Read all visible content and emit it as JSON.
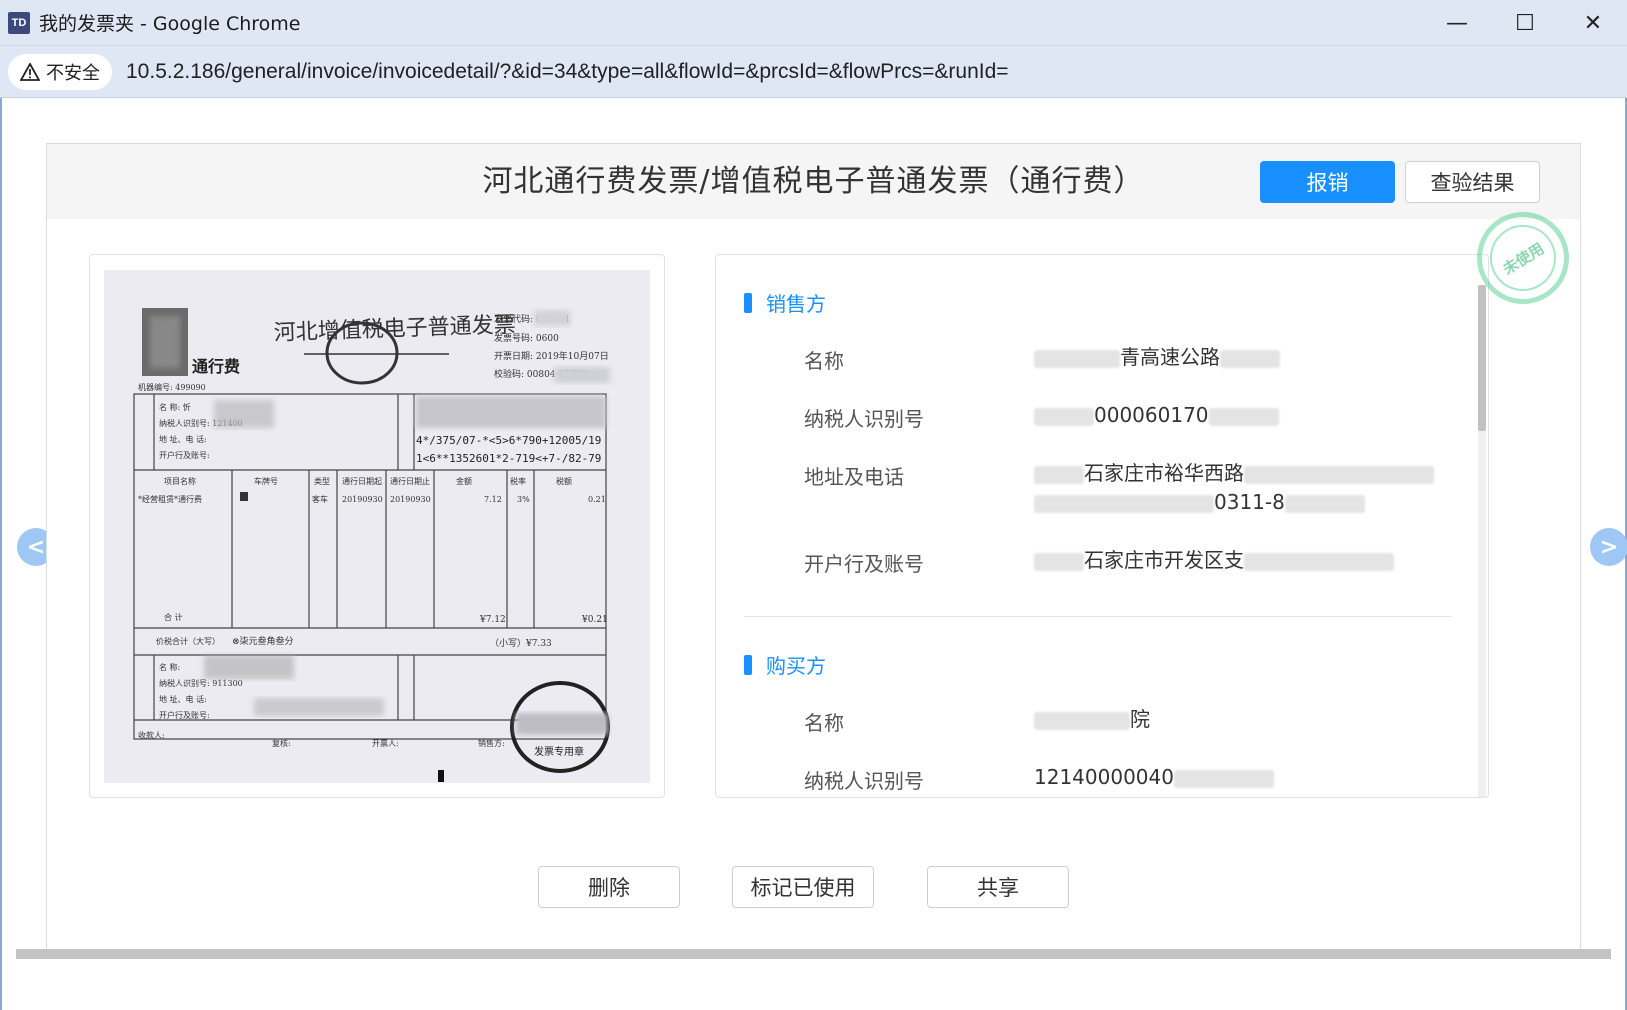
{
  "window": {
    "icon_text": "TD",
    "title": "我的发票夹 - Google Chrome",
    "minimize": "—",
    "maximize": "☐",
    "close": "✕"
  },
  "address": {
    "security_label": "不安全",
    "url": "10.5.2.186/general/invoice/invoicedetail/?&id=34&type=all&flowId=&prcsId=&flowPrcs=&runId="
  },
  "dialog": {
    "title": "河北通行费发票/增值税电子普通发票（通行费）",
    "reimburse_label": "报销",
    "verify_label": "查验结果",
    "stamp_text": "未使用"
  },
  "invoice_image": {
    "doc_title": "河北增值税电子普通发票",
    "subtitle": "通行费",
    "machine_no": "机器编号: 499090",
    "code_label": "发票代码: 013001",
    "number_label": "发票号码: 0600",
    "date_label": "开票日期: 2019年10月07日",
    "check_label": "校验码: 00804 15797",
    "buyer_name": "名   称: 忻",
    "buyer_tax": "纳税人识别号: 121400",
    "buyer_addr": "地 址、电 话:",
    "buyer_bank": "开户行及账号:",
    "cipher_1": "4*/375/07-*<5>6*790+12005/19",
    "cipher_2": "1<6**1352601*2-719<+7-/82-79",
    "col_item": "项目名称",
    "col_plate": "车牌号",
    "col_type": "类型",
    "col_start": "通行日期起",
    "col_end": "通行日期止",
    "col_amount": "金额",
    "col_rate": "税率",
    "col_tax": "税额",
    "item_name": "*经营租赁*通行费",
    "item_type": "客车",
    "item_start": "20190930",
    "item_end": "20190930",
    "item_amount": "7.12",
    "item_rate": "3%",
    "item_tax": "0.21",
    "total_label": "合    计",
    "total_amount": "¥7.12",
    "total_tax": "¥0.21",
    "sum_label": "价税合计（大写）",
    "sum_upper": "⊗柒元叁角叁分",
    "sum_small": "（小写）¥7.33",
    "seller_name": "名   称:",
    "seller_tax": "纳税人识别号: 911300",
    "seller_addr": "地 址、电 话:",
    "seller_bank": "开户行及账号:",
    "seal_text": "发票专用章",
    "payee": "收款人:",
    "reviewer": "复核:",
    "drawer": "开票人:",
    "sales": "销售方:"
  },
  "seller": {
    "section_title": "销售方",
    "name_label": "名称",
    "name_value": "青高速公路",
    "tax_label": "纳税人识别号",
    "tax_value": "000060170",
    "addr_label": "地址及电话",
    "addr_value_1": "石家庄市裕华西路",
    "addr_value_2": "0311-8",
    "bank_label": "开户行及账号",
    "bank_value": "石家庄市开发区支"
  },
  "buyer": {
    "section_title": "购买方",
    "name_label": "名称",
    "name_value": "院",
    "tax_label": "纳税人识别号",
    "tax_value": "12140000040"
  },
  "footer": {
    "delete_label": "删除",
    "mark_used_label": "标记已使用",
    "share_label": "共享"
  },
  "nav": {
    "prev": "<",
    "next": ">"
  }
}
